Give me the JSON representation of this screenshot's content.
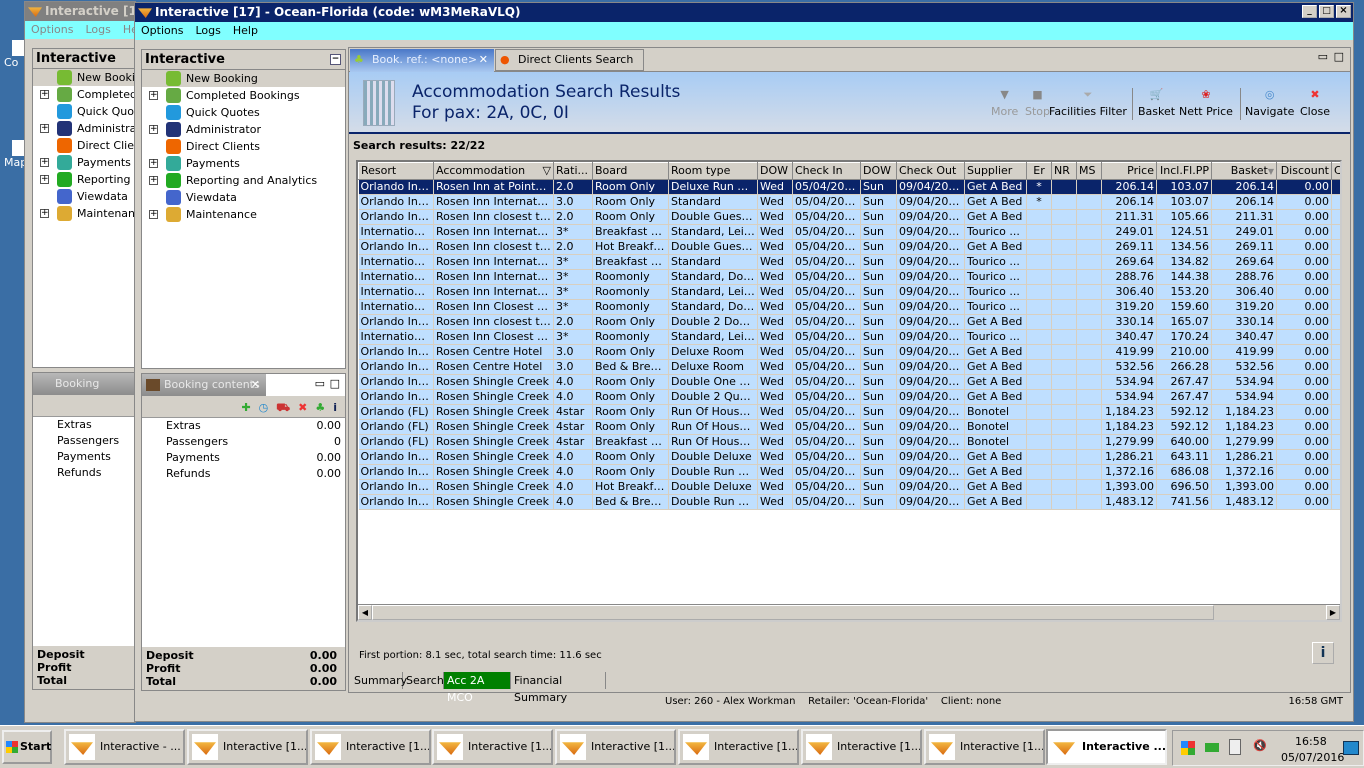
{
  "desktop": {
    "icons": [
      "Co",
      "Map"
    ]
  },
  "back_window": {
    "title": "Interactive [16",
    "menu": [
      "Options",
      "Logs",
      "Help"
    ],
    "panel_title": "Interactive",
    "tree": [
      "New Booking",
      "Completed Bookings",
      "Quick Quotes",
      "Administrator",
      "Direct Clients",
      "Payments",
      "Reporting and Analytics",
      "Viewdata",
      "Maintenance"
    ],
    "booking_title": "Booking contents",
    "rows": [
      "Extras",
      "Passengers",
      "Payments",
      "Refunds"
    ],
    "footer": [
      "Deposit",
      "Profit",
      "Total"
    ]
  },
  "window": {
    "title": "Interactive [17] - Ocean-Florida (code: wM3MeRaVLQ)",
    "menu": [
      "Options",
      "Logs",
      "Help"
    ]
  },
  "nav": {
    "title": "Interactive",
    "items": [
      {
        "label": "New Booking",
        "expand": false,
        "icon": "palm-tree-icon",
        "selected": true
      },
      {
        "label": "Completed Bookings",
        "expand": true,
        "icon": "palm-money-icon"
      },
      {
        "label": "Quick Quotes",
        "expand": false,
        "icon": "clock-icon"
      },
      {
        "label": "Administrator",
        "expand": true,
        "icon": "runner-icon"
      },
      {
        "label": "Direct Clients",
        "expand": false,
        "icon": "person-icon"
      },
      {
        "label": "Payments",
        "expand": true,
        "icon": "dollar-card-icon"
      },
      {
        "label": "Reporting and Analytics",
        "expand": true,
        "icon": "report-icon"
      },
      {
        "label": "Viewdata",
        "expand": false,
        "icon": "globe-icon"
      },
      {
        "label": "Maintenance",
        "expand": true,
        "icon": "books-icon"
      }
    ]
  },
  "booking": {
    "title": "Booking contents",
    "rows": [
      {
        "label": "Extras",
        "value": "0.00"
      },
      {
        "label": "Passengers",
        "value": "0"
      },
      {
        "label": "Payments",
        "value": "0.00"
      },
      {
        "label": "Refunds",
        "value": "0.00"
      }
    ],
    "footer": [
      {
        "label": "Deposit",
        "value": "0.00"
      },
      {
        "label": "Profit",
        "value": "0.00"
      },
      {
        "label": "Total",
        "value": "0.00"
      }
    ]
  },
  "tabs": [
    {
      "label": "Book. ref.: <none>",
      "active": true
    },
    {
      "label": "Direct Clients Search",
      "active": false
    }
  ],
  "header": {
    "title": "Accommodation Search Results",
    "subtitle": "For pax: 2A, 0C, 0I"
  },
  "toolbar": [
    {
      "label": "More",
      "enabled": false
    },
    {
      "label": "Stop",
      "enabled": false
    },
    {
      "label": "Facilities Filter",
      "enabled": true
    },
    {
      "label": "Basket",
      "enabled": true
    },
    {
      "label": "Nett Price",
      "enabled": true
    },
    {
      "label": "Navigate",
      "enabled": true
    },
    {
      "label": "Close",
      "enabled": true
    }
  ],
  "results_label": "Search results: 22/22",
  "columns": [
    "Resort",
    "Accommodation",
    "Rati...",
    "Board",
    "Room type",
    "DOW",
    "Check In",
    "DOW",
    "Check Out",
    "Supplier",
    "Er",
    "NR",
    "MS",
    "Price",
    "Incl.Fl.PP",
    "Basket",
    "Discount",
    "C"
  ],
  "rows": [
    [
      "Orlando Int...",
      "Rosen Inn at Pointe ...",
      "2.0",
      "Room Only",
      "Deluxe Run Of...",
      "Wed",
      "05/04/2017",
      "Sun",
      "09/04/2017",
      "Get A Bed",
      "*",
      "",
      "",
      "206.14",
      "103.07",
      "206.14",
      "0.00",
      ""
    ],
    [
      "Orlando Int...",
      "Rosen Inn Internatio...",
      "3.0",
      "Room Only",
      "Standard",
      "Wed",
      "05/04/2017",
      "Sun",
      "09/04/2017",
      "Get A Bed",
      "*",
      "",
      "",
      "206.14",
      "103.07",
      "206.14",
      "0.00",
      ""
    ],
    [
      "Orlando Int...",
      "Rosen Inn closest to ...",
      "2.0",
      "Room Only",
      "Double Guest ...",
      "Wed",
      "05/04/2017",
      "Sun",
      "09/04/2017",
      "Get A Bed",
      "",
      "",
      "",
      "211.31",
      "105.66",
      "211.31",
      "0.00",
      ""
    ],
    [
      "Internation...",
      "Rosen Inn International",
      "3*",
      "Breakfast B...",
      "Standard, Leis...",
      "Wed",
      "05/04/2017",
      "Sun",
      "09/04/2017",
      "Tourico ...",
      "",
      "",
      "",
      "249.01",
      "124.51",
      "249.01",
      "0.00",
      ""
    ],
    [
      "Orlando Int...",
      "Rosen Inn closest to ...",
      "2.0",
      "Hot Breakfast",
      "Double Guest ...",
      "Wed",
      "05/04/2017",
      "Sun",
      "09/04/2017",
      "Get A Bed",
      "",
      "",
      "",
      "269.11",
      "134.56",
      "269.11",
      "0.00",
      ""
    ],
    [
      "Internation...",
      "Rosen Inn International",
      "3*",
      "Breakfast B...",
      "Standard",
      "Wed",
      "05/04/2017",
      "Sun",
      "09/04/2017",
      "Tourico ...",
      "",
      "",
      "",
      "269.64",
      "134.82",
      "269.64",
      "0.00",
      ""
    ],
    [
      "Internation...",
      "Rosen Inn International",
      "3*",
      "Roomonly",
      "Standard, Double",
      "Wed",
      "05/04/2017",
      "Sun",
      "09/04/2017",
      "Tourico ...",
      "",
      "",
      "",
      "288.76",
      "144.38",
      "288.76",
      "0.00",
      ""
    ],
    [
      "Internation...",
      "Rosen Inn International",
      "3*",
      "Roomonly",
      "Standard, Leis...",
      "Wed",
      "05/04/2017",
      "Sun",
      "09/04/2017",
      "Tourico ...",
      "",
      "",
      "",
      "306.40",
      "153.20",
      "306.40",
      "0.00",
      ""
    ],
    [
      "Internation...",
      "Rosen Inn Closest to...",
      "3*",
      "Roomonly",
      "Standard, Double",
      "Wed",
      "05/04/2017",
      "Sun",
      "09/04/2017",
      "Tourico ...",
      "",
      "",
      "",
      "319.20",
      "159.60",
      "319.20",
      "0.00",
      ""
    ],
    [
      "Orlando Int...",
      "Rosen Inn closest to ...",
      "2.0",
      "Room Only",
      "Double 2  Dou...",
      "Wed",
      "05/04/2017",
      "Sun",
      "09/04/2017",
      "Get A Bed",
      "",
      "",
      "",
      "330.14",
      "165.07",
      "330.14",
      "0.00",
      ""
    ],
    [
      "Internation...",
      "Rosen Inn Closest to...",
      "3*",
      "Roomonly",
      "Standard, Leis...",
      "Wed",
      "05/04/2017",
      "Sun",
      "09/04/2017",
      "Tourico ...",
      "",
      "",
      "",
      "340.47",
      "170.24",
      "340.47",
      "0.00",
      ""
    ],
    [
      "Orlando Int...",
      "Rosen Centre Hotel",
      "3.0",
      "Room Only",
      "Deluxe Room",
      "Wed",
      "05/04/2017",
      "Sun",
      "09/04/2017",
      "Get A Bed",
      "",
      "",
      "",
      "419.99",
      "210.00",
      "419.99",
      "0.00",
      ""
    ],
    [
      "Orlando Int...",
      "Rosen Centre Hotel",
      "3.0",
      "Bed & Brea...",
      "Deluxe Room",
      "Wed",
      "05/04/2017",
      "Sun",
      "09/04/2017",
      "Get A Bed",
      "",
      "",
      "",
      "532.56",
      "266.28",
      "532.56",
      "0.00",
      ""
    ],
    [
      "Orlando Int...",
      "Rosen Shingle Creek",
      "4.0",
      "Room Only",
      "Double One Ki...",
      "Wed",
      "05/04/2017",
      "Sun",
      "09/04/2017",
      "Get A Bed",
      "",
      "",
      "",
      "534.94",
      "267.47",
      "534.94",
      "0.00",
      ""
    ],
    [
      "Orlando Int...",
      "Rosen Shingle Creek",
      "4.0",
      "Room Only",
      "Double 2 Quee...",
      "Wed",
      "05/04/2017",
      "Sun",
      "09/04/2017",
      "Get A Bed",
      "",
      "",
      "",
      "534.94",
      "267.47",
      "534.94",
      "0.00",
      ""
    ],
    [
      "Orlando (FL)",
      "Rosen Shingle Creek",
      "4star",
      "Room Only",
      "Run Of House ...",
      "Wed",
      "05/04/2017",
      "Sun",
      "09/04/2017",
      "Bonotel",
      "",
      "",
      "",
      "1,184.23",
      "592.12",
      "1,184.23",
      "0.00",
      ""
    ],
    [
      "Orlando (FL)",
      "Rosen Shingle Creek",
      "4star",
      "Room Only",
      "Run Of House ...",
      "Wed",
      "05/04/2017",
      "Sun",
      "09/04/2017",
      "Bonotel",
      "",
      "",
      "",
      "1,184.23",
      "592.12",
      "1,184.23",
      "0.00",
      ""
    ],
    [
      "Orlando (FL)",
      "Rosen Shingle Creek",
      "4star",
      "Breakfast B...",
      "Run Of House ...",
      "Wed",
      "05/04/2017",
      "Sun",
      "09/04/2017",
      "Bonotel",
      "",
      "",
      "",
      "1,279.99",
      "640.00",
      "1,279.99",
      "0.00",
      ""
    ],
    [
      "Orlando Int...",
      "Rosen Shingle Creek",
      "4.0",
      "Room Only",
      "Double Deluxe",
      "Wed",
      "05/04/2017",
      "Sun",
      "09/04/2017",
      "Get A Bed",
      "",
      "",
      "",
      "1,286.21",
      "643.11",
      "1,286.21",
      "0.00",
      ""
    ],
    [
      "Orlando Int...",
      "Rosen Shingle Creek",
      "4.0",
      "Room Only",
      "Double Run Of...",
      "Wed",
      "05/04/2017",
      "Sun",
      "09/04/2017",
      "Get A Bed",
      "",
      "",
      "",
      "1,372.16",
      "686.08",
      "1,372.16",
      "0.00",
      ""
    ],
    [
      "Orlando Int...",
      "Rosen Shingle Creek",
      "4.0",
      "Hot Breakfast",
      "Double Deluxe",
      "Wed",
      "05/04/2017",
      "Sun",
      "09/04/2017",
      "Get A Bed",
      "",
      "",
      "",
      "1,393.00",
      "696.50",
      "1,393.00",
      "0.00",
      ""
    ],
    [
      "Orlando Int...",
      "Rosen Shingle Creek",
      "4.0",
      "Bed & Brea...",
      "Double Run Of...",
      "Wed",
      "05/04/2017",
      "Sun",
      "09/04/2017",
      "Get A Bed",
      "",
      "",
      "",
      "1,483.12",
      "741.56",
      "1,483.12",
      "0.00",
      ""
    ]
  ],
  "timing": "First portion: 8.1 sec, total search time: 11.6 sec",
  "bottom_tabs": [
    {
      "label": "Summary"
    },
    {
      "label": "Search"
    },
    {
      "label": "Acc 2A MCO",
      "active": true
    },
    {
      "label": "Financial Summary"
    }
  ],
  "status": {
    "user": "User: 260 - Alex Workman",
    "retailer": "Retailer: 'Ocean-Florida'",
    "client": "Client: none",
    "time": "16:58 GMT"
  },
  "taskbar": {
    "start": "Start",
    "items": [
      "Interactive - ...",
      "Interactive [1...",
      "Interactive [1...",
      "Interactive [1...",
      "Interactive [1...",
      "Interactive [1...",
      "Interactive [1...",
      "Interactive [1...",
      "Interactive ..."
    ],
    "clock_time": "16:58",
    "clock_date": "05/07/2016"
  },
  "colors": {
    "selected_row": "#0a246a",
    "row": "#bfdfff",
    "active_tab": "#008000",
    "menubar": "#80ffff",
    "title": "#0a246a"
  }
}
